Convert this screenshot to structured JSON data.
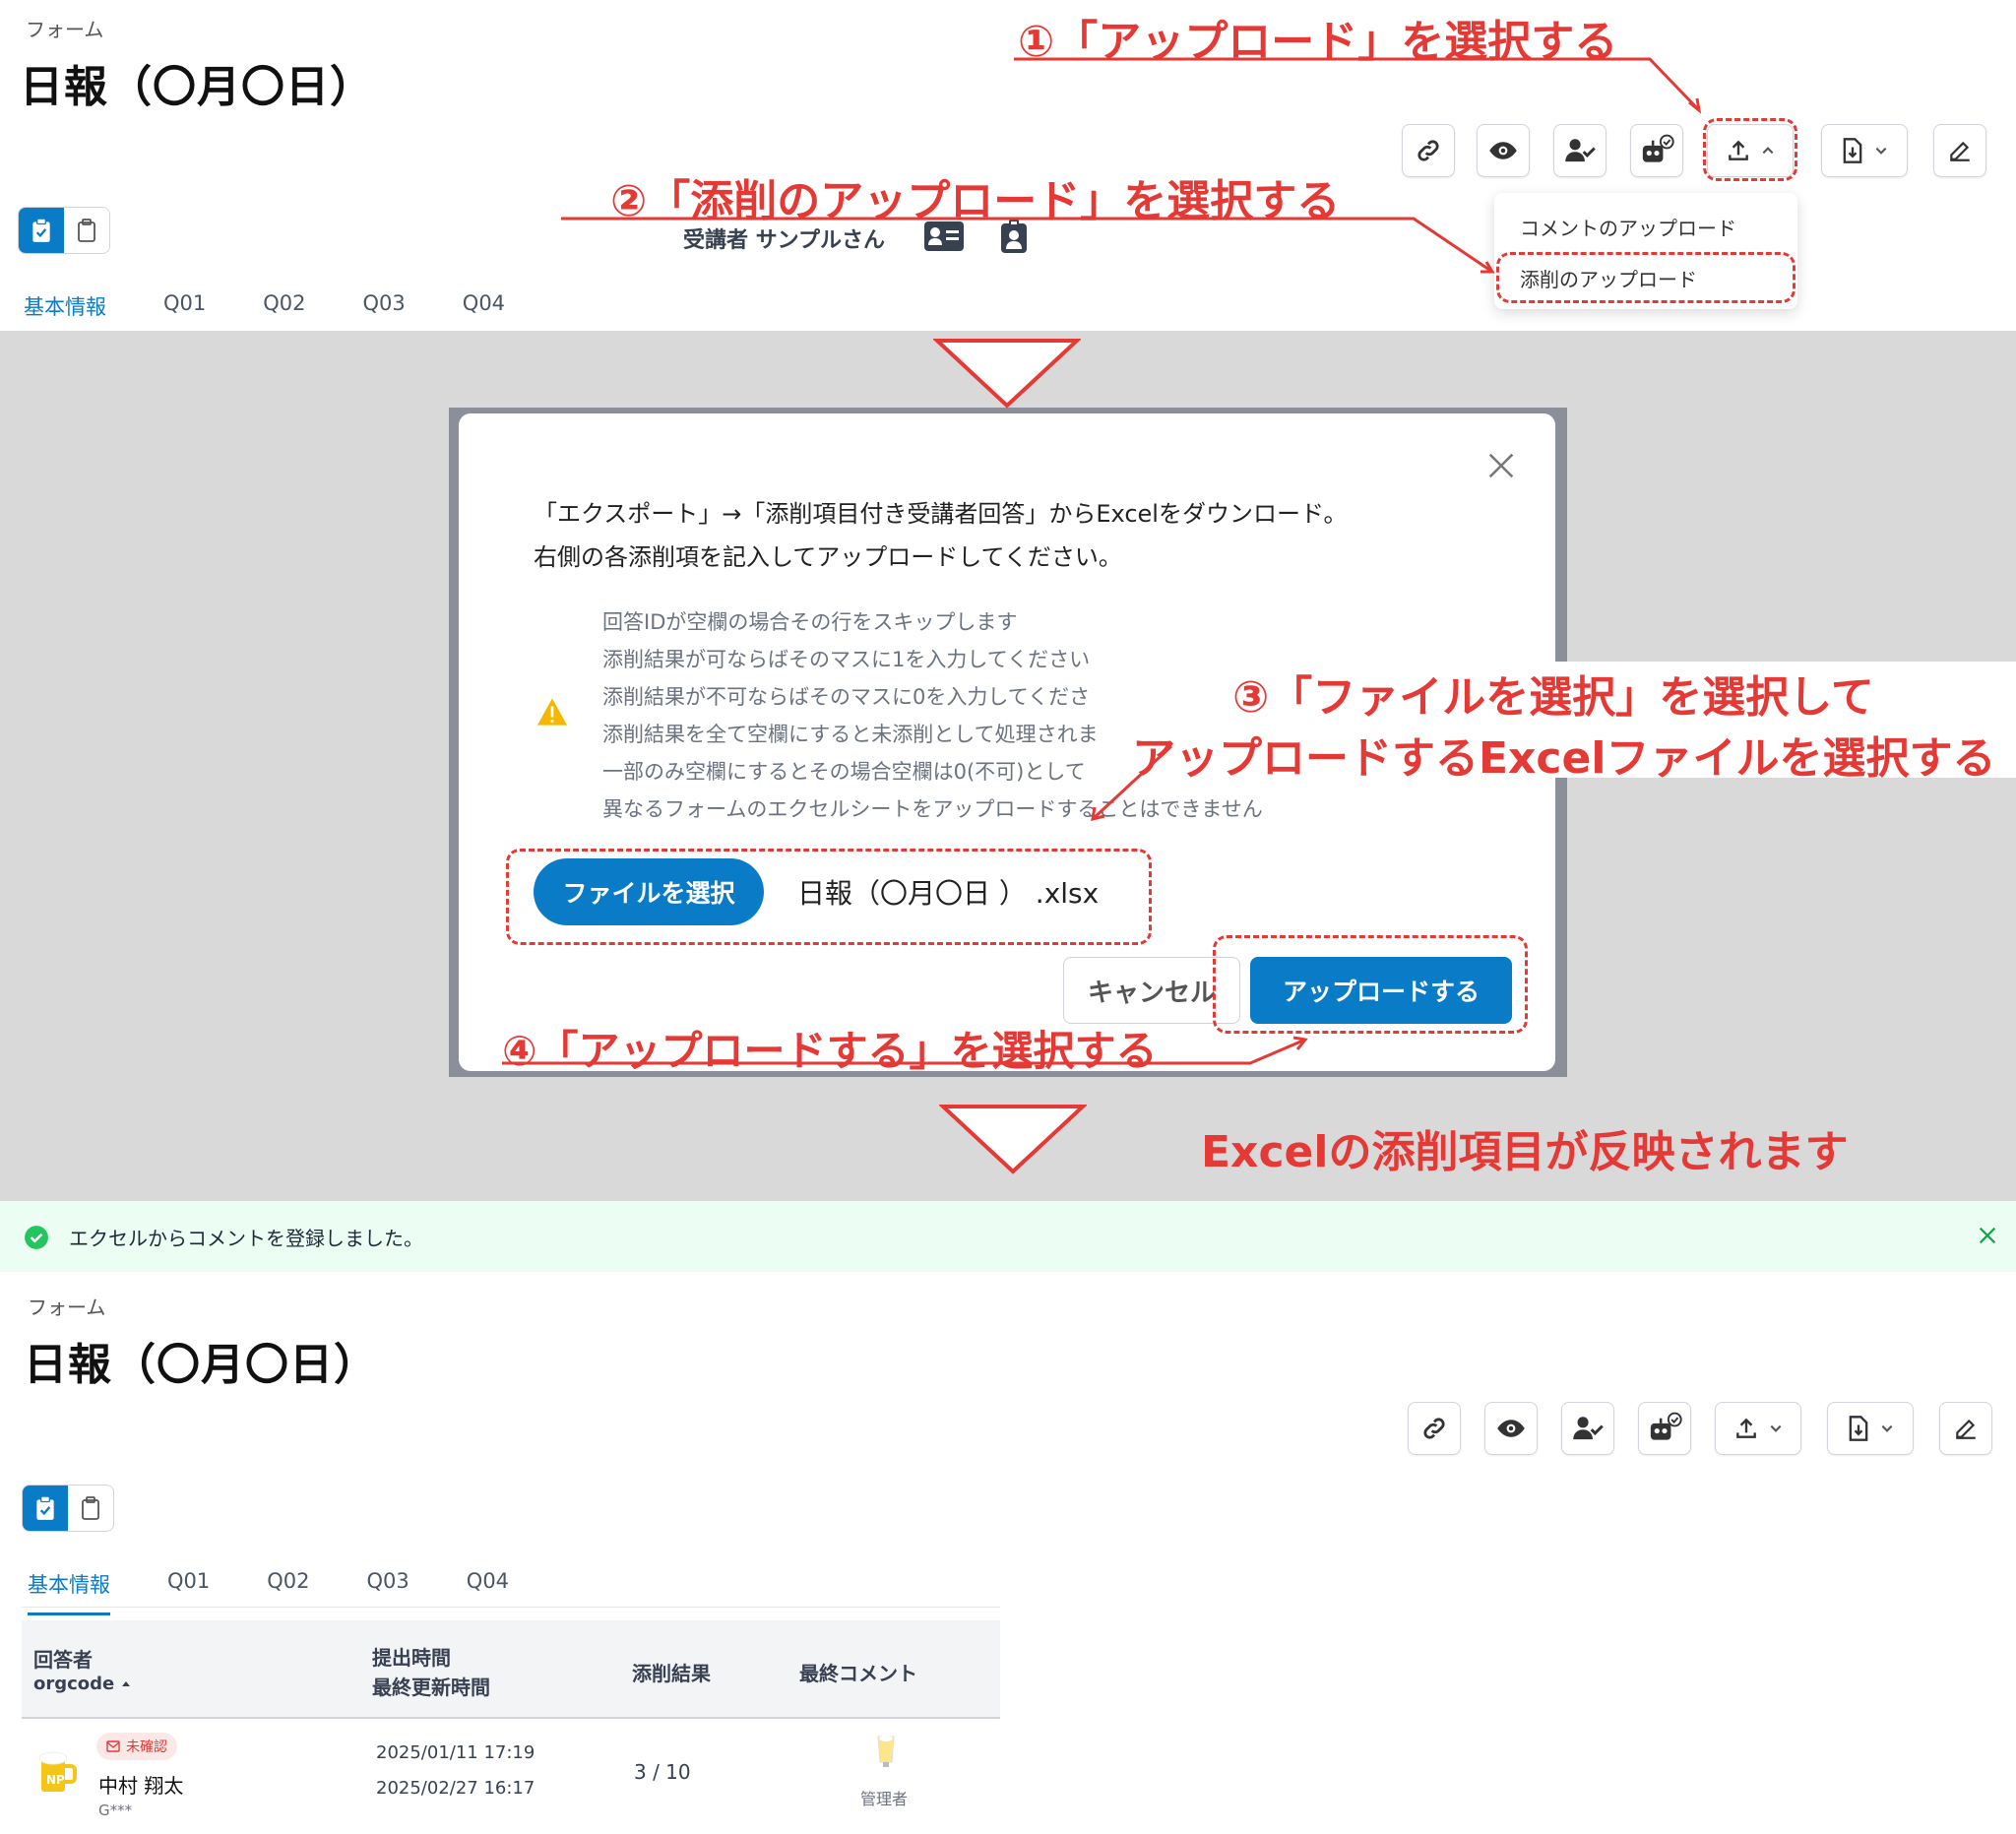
{
  "top": {
    "breadcrumb": "フォーム",
    "title": "日報（〇月〇日）",
    "tabs": [
      "基本情報",
      "Q01",
      "Q02",
      "Q03",
      "Q04"
    ],
    "respondent": "受講者 サンプルさん",
    "upload_menu": [
      "コメントのアップロード",
      "添削のアップロード"
    ]
  },
  "annotations": {
    "step1": "①「アップロード」を選択する",
    "step2": "②「添削のアップロード」を選択する",
    "step3_line1": "③「ファイルを選択」を選択して",
    "step3_line2": "アップロードするExcelファイルを選択する",
    "step4": "④「アップロードする」を選択する",
    "result": "Excelの添削項目が反映されます"
  },
  "modal": {
    "intro_line1": "「エクスポート」→「添削項目付き受講者回答」からExcelをダウンロード。",
    "intro_line2": "右側の各添削項を記入してアップロードしてください。",
    "notes": [
      "回答IDが空欄の場合その行をスキップします",
      "添削結果が可ならばそのマスに1を入力してください",
      "添削結果が不可ならばそのマスに0を入力してくださ",
      "添削結果を全て空欄にすると未添削として処理されま",
      "一部のみ空欄にするとその場合空欄は0(不可)として",
      "異なるフォームのエクセルシートをアップロードすることはできません"
    ],
    "file_button": "ファイルを選択",
    "file_name": "日報（〇月〇日 ） .xlsx",
    "cancel_button": "キャンセル",
    "upload_button": "アップロードする"
  },
  "toast": {
    "message": "エクセルからコメントを登録しました。"
  },
  "bottom": {
    "breadcrumb": "フォーム",
    "title": "日報（〇月〇日）",
    "tabs": [
      "基本情報",
      "Q01",
      "Q02",
      "Q03",
      "Q04"
    ],
    "table": {
      "headers": {
        "respondent": "回答者",
        "orgcode": "orgcode",
        "submitted": "提出時間",
        "updated": "最終更新時間",
        "result": "添削結果",
        "comment": "最終コメント"
      },
      "row": {
        "badge": "未確認",
        "name": "中村 翔太",
        "org": "G***",
        "submitted": "2025/01/11 17:19",
        "updated": "2025/02/27 16:17",
        "result": "3 / 10",
        "commenter": "管理者"
      }
    }
  },
  "colors": {
    "accent": "#0a7bc7",
    "annotation": "#e53935",
    "success": "#22c55e"
  }
}
